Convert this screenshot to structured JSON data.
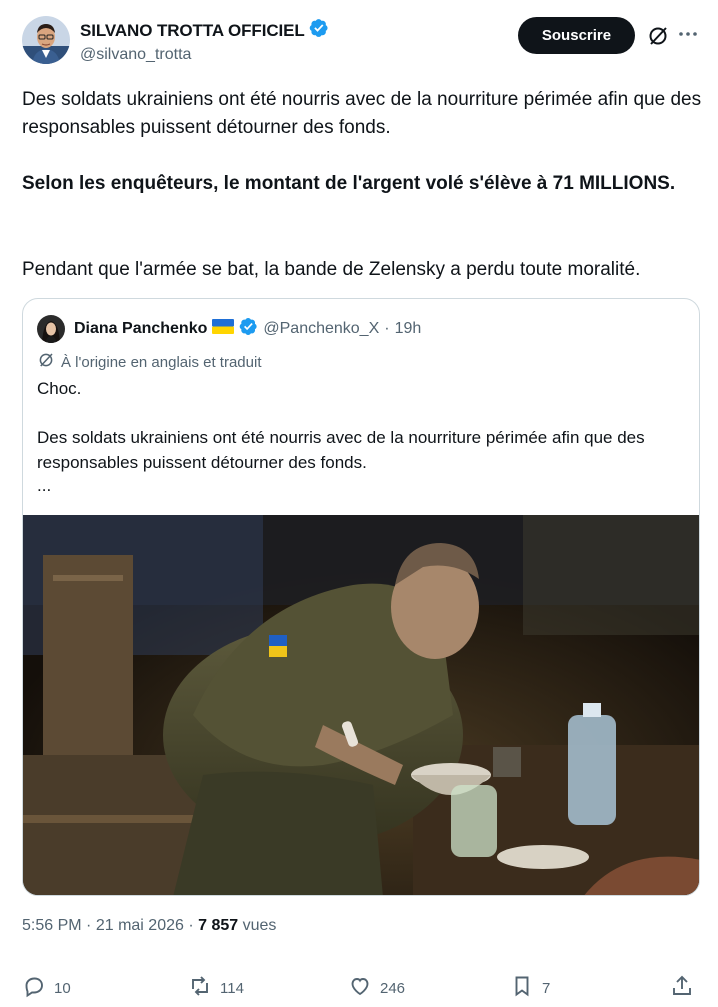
{
  "author": {
    "display_name": "SILVANO TROTTA OFFICIEL",
    "handle": "@silvano_trotta",
    "avatar_icon": "avatar-photo",
    "verified_icon": "verified-badge-icon"
  },
  "header": {
    "subscribe_label": "Souscrire",
    "grok_icon": "grok-icon",
    "more_icon": "more-icon"
  },
  "tweet_text": {
    "p1": "Des soldats ukrainiens ont été nourris avec de la nourriture périmée afin que des responsables puissent détourner des fonds.",
    "p2": "Selon les enquêteurs, le montant de l'argent volé s'élève à 71 MILLIONS.",
    "p3": "Pendant que l'armée se bat, la bande de Zelensky a perdu toute moralité."
  },
  "quote": {
    "display_name": "Diana Panchenko",
    "flag": "🇺🇦",
    "handle": "@Panchenko_X",
    "separator": "·",
    "time": "19h",
    "translated_label": "À l'origine en anglais et traduit",
    "text_1": "Choc.",
    "text_2": "Des soldats ukrainiens ont été nourris avec de la nourriture périmée afin que des responsables puissent détourner des fonds.",
    "text_3": "..."
  },
  "meta": {
    "time": "5:56 PM",
    "date": "· 21 mai 2026 ·",
    "views_count": "7 857",
    "views_label": "vues"
  },
  "actions": {
    "replies": "10",
    "reposts": "114",
    "likes": "246",
    "bookmarks": "7"
  },
  "colors": {
    "text": "#0f1419",
    "secondary": "#536471",
    "verified": "#1d9bf0",
    "border": "#cfd9de",
    "button_bg": "#0f1419"
  }
}
